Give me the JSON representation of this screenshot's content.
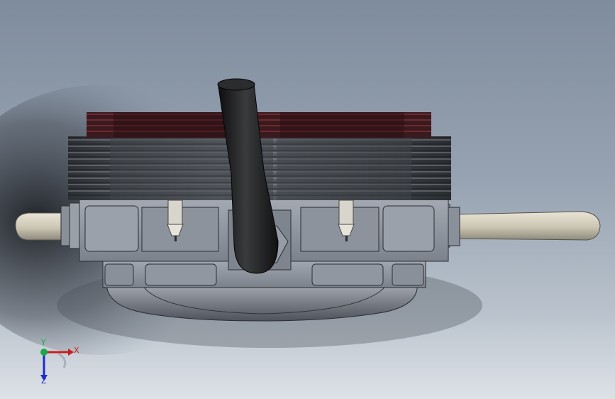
{
  "viewport": {
    "background_top": "#7f8c9d",
    "background_bottom": "#dde2e7"
  },
  "model": {
    "body_color": "#8f959f",
    "fin_color": "#5a5e66",
    "head_fin_color": "#3a1a1e",
    "intake_pipe_color": "#1b1b1c",
    "exhaust_pipe_color": "#cbc5b3"
  },
  "triad": {
    "x_label": "X",
    "y_label": "Y",
    "z_label": "Z",
    "x_color": "#c81e1e",
    "y_color": "#1aa84a",
    "z_color": "#1b2ad0"
  }
}
